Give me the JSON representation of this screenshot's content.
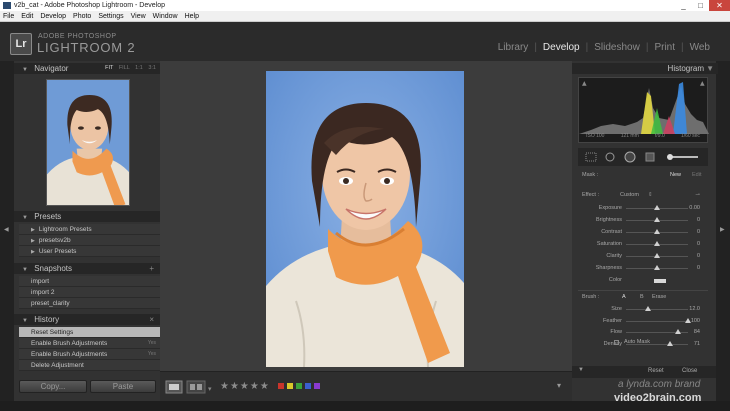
{
  "window": {
    "title": "v2b_cat - Adobe Photoshop Lightroom - Develop"
  },
  "menu": [
    "File",
    "Edit",
    "Develop",
    "Photo",
    "Settings",
    "View",
    "Window",
    "Help"
  ],
  "brand": {
    "logo": "Lr",
    "line1": "ADOBE PHOTOSHOP",
    "line2": "LIGHTROOM 2"
  },
  "modules": [
    "Library",
    "Develop",
    "Slideshow",
    "Print",
    "Web"
  ],
  "active_module": "Develop",
  "navigator": {
    "title": "Navigator",
    "options": [
      "FIT",
      "FILL",
      "1:1",
      "3:1"
    ]
  },
  "presets": {
    "title": "Presets",
    "items": [
      "Lightroom Presets",
      "presetsv2b",
      "User Presets"
    ]
  },
  "snapshots": {
    "title": "Snapshots",
    "items": [
      "import",
      "import 2",
      "preset_clarity"
    ]
  },
  "history": {
    "title": "History",
    "items": [
      "Reset Settings",
      "Enable Brush Adjustments",
      "Enable Brush Adjustments",
      "Delete Adjustment"
    ],
    "timestamps": [
      "",
      "Yes",
      "Yes",
      ""
    ]
  },
  "left_buttons": {
    "copy": "Copy...",
    "paste": "Paste"
  },
  "histogram": {
    "title": "Histogram",
    "info": [
      "ISO 100",
      "121 mm",
      "f/9.0",
      "1/60 sec"
    ]
  },
  "mask": {
    "label": "Mask :",
    "new": "New",
    "edit": "Edit"
  },
  "effect": {
    "label": "Effect :",
    "value": "Custom"
  },
  "sliders": [
    {
      "label": "Exposure",
      "value": "0.00",
      "pos": 0.5
    },
    {
      "label": "Brightness",
      "value": "0",
      "pos": 0.5
    },
    {
      "label": "Contrast",
      "value": "0",
      "pos": 0.5
    },
    {
      "label": "Saturation",
      "value": "0",
      "pos": 0.5
    },
    {
      "label": "Clarity",
      "value": "0",
      "pos": 0.5
    },
    {
      "label": "Sharpness",
      "value": "0",
      "pos": 0.5
    }
  ],
  "color_label": "Color",
  "brush": {
    "label": "Brush :",
    "a": "A",
    "b": "B",
    "erase": "Erase"
  },
  "brush_sliders": [
    {
      "label": "Size",
      "value": "12.0",
      "pos": 0.35
    },
    {
      "label": "Feather",
      "value": "100",
      "pos": 1.0
    },
    {
      "label": "Flow",
      "value": "84",
      "pos": 0.84
    },
    {
      "label": "Density",
      "value": "71",
      "pos": 0.71
    }
  ],
  "auto_mask": "Auto Mask",
  "right_buttons": {
    "reset": "Reset",
    "close": "Close"
  },
  "watermark": {
    "line1": "a lynda.com brand",
    "line2": "video2brain.com"
  },
  "color_labels": [
    "#c8342b",
    "#d8c82a",
    "#3aa23a",
    "#3a5fcf",
    "#8a3acf"
  ],
  "rating_stars": 5
}
